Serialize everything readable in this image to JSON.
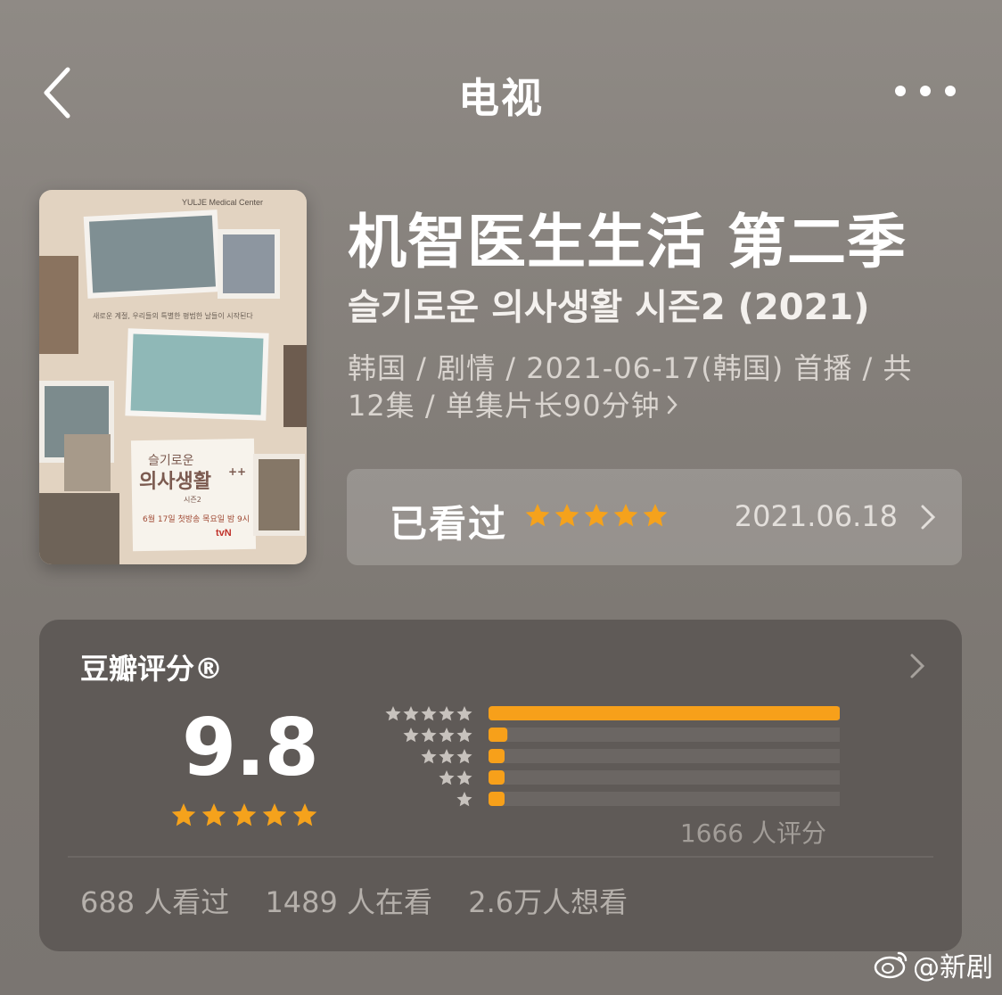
{
  "nav": {
    "title": "电视"
  },
  "show": {
    "title": "机智医生生活 第二季",
    "original_title": "슬기로운 의사생활 시즌2 (2021)",
    "meta": "韩国 / 剧情 / 2021-06-17(韩国) 首播 / 共12集 / 单集片长90分钟",
    "poster": {
      "top_text": "YULJE Medical Center",
      "tagline": "새로운 계절, 우리들의 특별한 평범한 날들이 시작된다",
      "logo_line1": "슬기로운",
      "logo_line2": "의사생활",
      "logo_sup": "++",
      "season": "시즌2",
      "handwriting": "6월 17일 첫방송 목요일 밤 9시",
      "brand": "tvN"
    }
  },
  "watched": {
    "label": "已看过",
    "stars": 5,
    "date": "2021.06.18"
  },
  "rating": {
    "heading": "豆瓣评分®",
    "score": "9.8",
    "score_stars": 5,
    "count_text": "1666 人评分",
    "distribution": [
      {
        "stars": 5,
        "fraction": 0.93
      },
      {
        "stars": 4,
        "fraction": 0.05
      },
      {
        "stars": 3,
        "fraction": 0.02
      },
      {
        "stars": 2,
        "fraction": 0.02
      },
      {
        "stars": 1,
        "fraction": 0.02
      }
    ],
    "stats": {
      "watched": "688 人看过",
      "watching": "1489 人在看",
      "want": "2.6万人想看"
    }
  },
  "watermark": "@新剧",
  "icons": [
    "back-chevron-icon",
    "more-dots-icon",
    "star-icon",
    "chevron-right-icon",
    "weibo-icon"
  ],
  "colors": {
    "star": "#f5a21c",
    "bar_fill": "#f7a01a",
    "bar_track": "#6b6663",
    "card": "#5f5a57"
  }
}
